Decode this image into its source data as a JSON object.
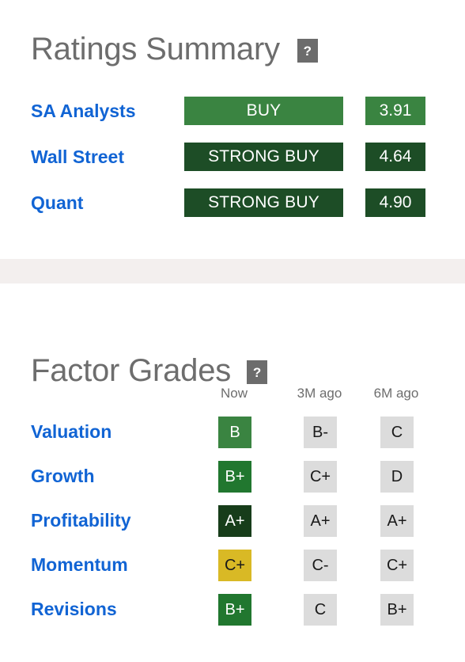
{
  "ratings": {
    "title": "Ratings Summary",
    "help_icon_label": "?",
    "rows": [
      {
        "label": "SA Analysts",
        "rating": "BUY",
        "score": "3.91",
        "bar_color": "#3a8441",
        "score_color": "#3a8441",
        "text_color": "#ffffff"
      },
      {
        "label": "Wall Street",
        "rating": "STRONG BUY",
        "score": "4.64",
        "bar_color": "#1d4d26",
        "score_color": "#1d4d26",
        "text_color": "#ffffff"
      },
      {
        "label": "Quant",
        "rating": "STRONG BUY",
        "score": "4.90",
        "bar_color": "#1d4d26",
        "score_color": "#1d4d26",
        "text_color": "#ffffff"
      }
    ]
  },
  "factors": {
    "title": "Factor Grades",
    "help_icon_label": "?",
    "columns": [
      "Now",
      "3M ago",
      "6M ago"
    ],
    "rows": [
      {
        "label": "Valuation",
        "grades": [
          {
            "value": "B",
            "bg": "#3a8441",
            "fg": "#ffffff"
          },
          {
            "value": "B-",
            "bg": "#dcdcdc",
            "fg": "#1a1a1a"
          },
          {
            "value": "C",
            "bg": "#dcdcdc",
            "fg": "#1a1a1a"
          }
        ]
      },
      {
        "label": "Growth",
        "grades": [
          {
            "value": "B+",
            "bg": "#21772f",
            "fg": "#ffffff"
          },
          {
            "value": "C+",
            "bg": "#dcdcdc",
            "fg": "#1a1a1a"
          },
          {
            "value": "D",
            "bg": "#dcdcdc",
            "fg": "#1a1a1a"
          }
        ]
      },
      {
        "label": "Profitability",
        "grades": [
          {
            "value": "A+",
            "bg": "#173d1a",
            "fg": "#ffffff"
          },
          {
            "value": "A+",
            "bg": "#dcdcdc",
            "fg": "#1a1a1a"
          },
          {
            "value": "A+",
            "bg": "#dcdcdc",
            "fg": "#1a1a1a"
          }
        ]
      },
      {
        "label": "Momentum",
        "grades": [
          {
            "value": "C+",
            "bg": "#d9b925",
            "fg": "#1a1a1a"
          },
          {
            "value": "C-",
            "bg": "#dcdcdc",
            "fg": "#1a1a1a"
          },
          {
            "value": "C+",
            "bg": "#dcdcdc",
            "fg": "#1a1a1a"
          }
        ]
      },
      {
        "label": "Revisions",
        "grades": [
          {
            "value": "B+",
            "bg": "#21772f",
            "fg": "#ffffff"
          },
          {
            "value": "C",
            "bg": "#dcdcdc",
            "fg": "#1a1a1a"
          },
          {
            "value": "B+",
            "bg": "#dcdcdc",
            "fg": "#1a1a1a"
          }
        ]
      }
    ]
  },
  "theme": {
    "link_blue": "#1164d4",
    "title_grey": "#6d6d6d",
    "band_grey": "#f3efee",
    "help_grey": "#6c6c6c"
  }
}
